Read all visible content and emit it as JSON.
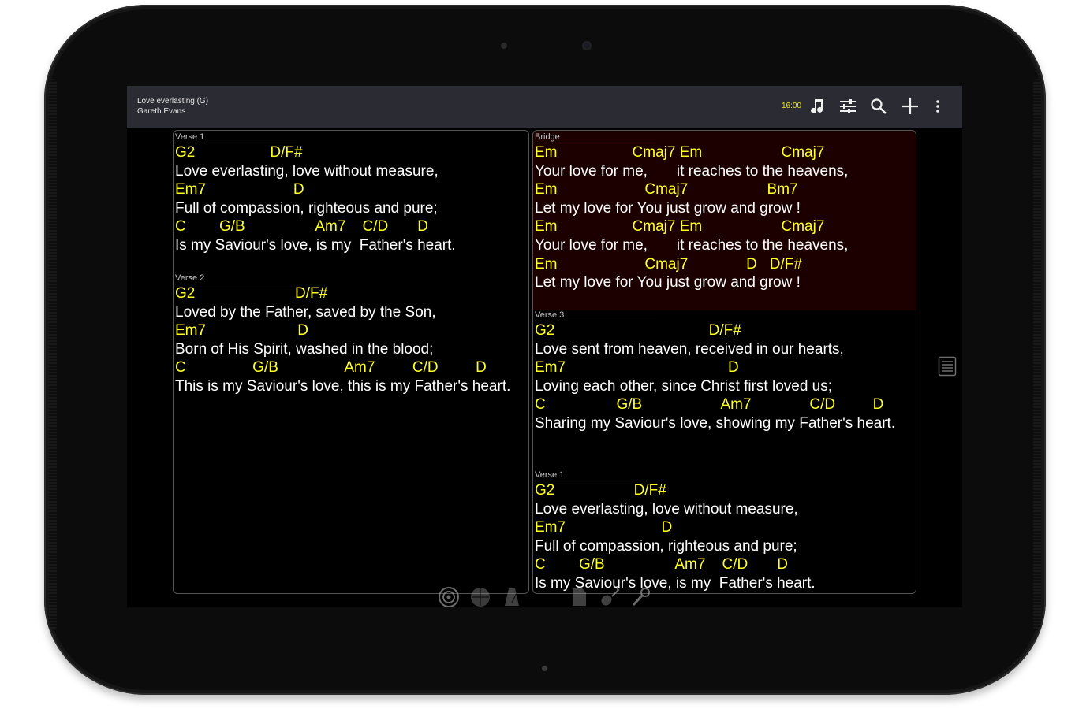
{
  "song": {
    "title": "Love everlasting (G)",
    "author": "Gareth Evans"
  },
  "toolbar": {
    "clock": "16:00",
    "icons": [
      "music-note-icon",
      "sliders-icon",
      "search-icon",
      "plus-icon",
      "overflow-menu-icon"
    ]
  },
  "accent_colors": {
    "chord": "#ffff21",
    "lyric": "#ffffff",
    "bridge_highlight": "#1c0000",
    "topbar": "#2b2b33"
  },
  "left_column": {
    "verse1": {
      "label": "Verse 1",
      "lines": [
        "G2                  D/F#",
        "Love everlasting, love without measure,",
        "Em7                     D",
        "Full of compassion, righteous and pure;",
        "C        G/B                 Am7    C/D       D",
        "Is my Saviour's love, is my  Father's heart."
      ]
    },
    "verse2": {
      "label": "Verse 2",
      "lines": [
        "G2                        D/F#",
        "Loved by the Father, saved by the Son,",
        "Em7                      D",
        "Born of His Spirit, washed in the blood;",
        "C                G/B                Am7         C/D         D",
        "This is my Saviour's love, this is my Father's heart."
      ]
    }
  },
  "right_column": {
    "bridge": {
      "label": "Bridge",
      "lines": [
        "Em                  Cmaj7 Em                   Cmaj7",
        "Your love for me,       it reaches to the heavens,",
        "Em                     Cmaj7                   Bm7",
        "Let my love for You just grow and grow !",
        "Em                  Cmaj7 Em                   Cmaj7",
        "Your love for me,       it reaches to the heavens,",
        "Em                     Cmaj7              D   D/F#",
        "Let my love for You just grow and grow !"
      ]
    },
    "verse3": {
      "label": "Verse 3",
      "lines": [
        "G2                                     D/F#",
        "Love sent from heaven, received in our hearts,",
        "Em7                                       D",
        "Loving each other, since Christ first loved us;",
        "C                 G/B                   Am7              C/D         D",
        "Sharing my Saviour's love, showing my Father's heart."
      ]
    },
    "verse1_repeat": {
      "label": "Verse 1",
      "lines": [
        "G2                   D/F#",
        "Love everlasting, love without measure,",
        "Em7                       D",
        "Full of compassion, righteous and pure;",
        "C        G/B                 Am7    C/D       D",
        "Is my Saviour's love, is my  Father's heart."
      ]
    }
  },
  "side": {
    "icon": "list-icon"
  },
  "bottom_bar": {
    "icons": [
      "speaker-icon",
      "clock-icon",
      "metronome-icon",
      "note-icon",
      "guitar-icon",
      "microphone-icon"
    ]
  }
}
